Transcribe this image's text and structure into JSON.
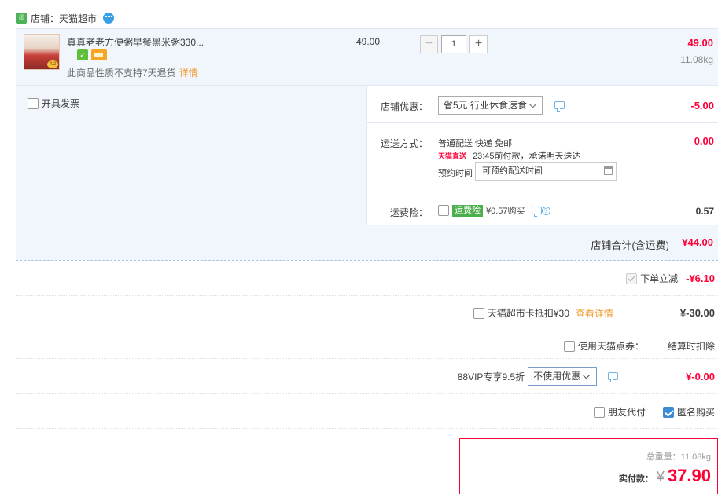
{
  "shop": {
    "label": "店铺：天猫超市"
  },
  "item": {
    "title": "真真老老方便粥早餐黑米粥330...",
    "note": "此商品性质不支持7天退货",
    "note_link": "详情",
    "unit_price": "49.00",
    "qty": "1",
    "qty_minus": "−",
    "qty_plus": "+",
    "total": "49.00",
    "weight": "11.08kg"
  },
  "invoice": {
    "label": "开具发票"
  },
  "shop_discount": {
    "label": "店铺优惠：",
    "selected": "省5元:行业休食速食",
    "amount": "-5.00"
  },
  "shipping": {
    "label": "运送方式：",
    "line1": "普通配送 快递 免邮",
    "direct_tag": "天猫直送",
    "line2": "23:45前付款，承诺明天送达",
    "appt_label": "预约时间",
    "appt_placeholder": "可预约配送时间",
    "amount": "0.00"
  },
  "insurance": {
    "label": "运费险：",
    "tag": "运费险",
    "text": "¥0.57购买",
    "help": "?",
    "amount": "0.57"
  },
  "shop_total": {
    "label": "店铺合计(含运费)",
    "value": "¥44.00"
  },
  "summary": {
    "instant": {
      "label": "下单立减",
      "amount": "-¥6.10"
    },
    "card": {
      "label": "天猫超市卡抵扣¥30",
      "link": "查看详情",
      "amount": "¥-30.00"
    },
    "points": {
      "label": "使用天猫点券：",
      "note": "结算时扣除"
    },
    "vip": {
      "label": "88VIP专享9.5折",
      "selected": "不使用优惠",
      "amount": "¥-0.00"
    },
    "friend": {
      "label": "朋友代付"
    },
    "anon": {
      "label": "匿名购买"
    }
  },
  "pay": {
    "weight": "总重量：11.08kg",
    "label": "实付款：",
    "yen": "¥",
    "value": "37.90"
  },
  "colors": {
    "accent_red": "#ff0036",
    "link_orange": "#f09b2d",
    "row_blue": "#f1f6fd"
  }
}
